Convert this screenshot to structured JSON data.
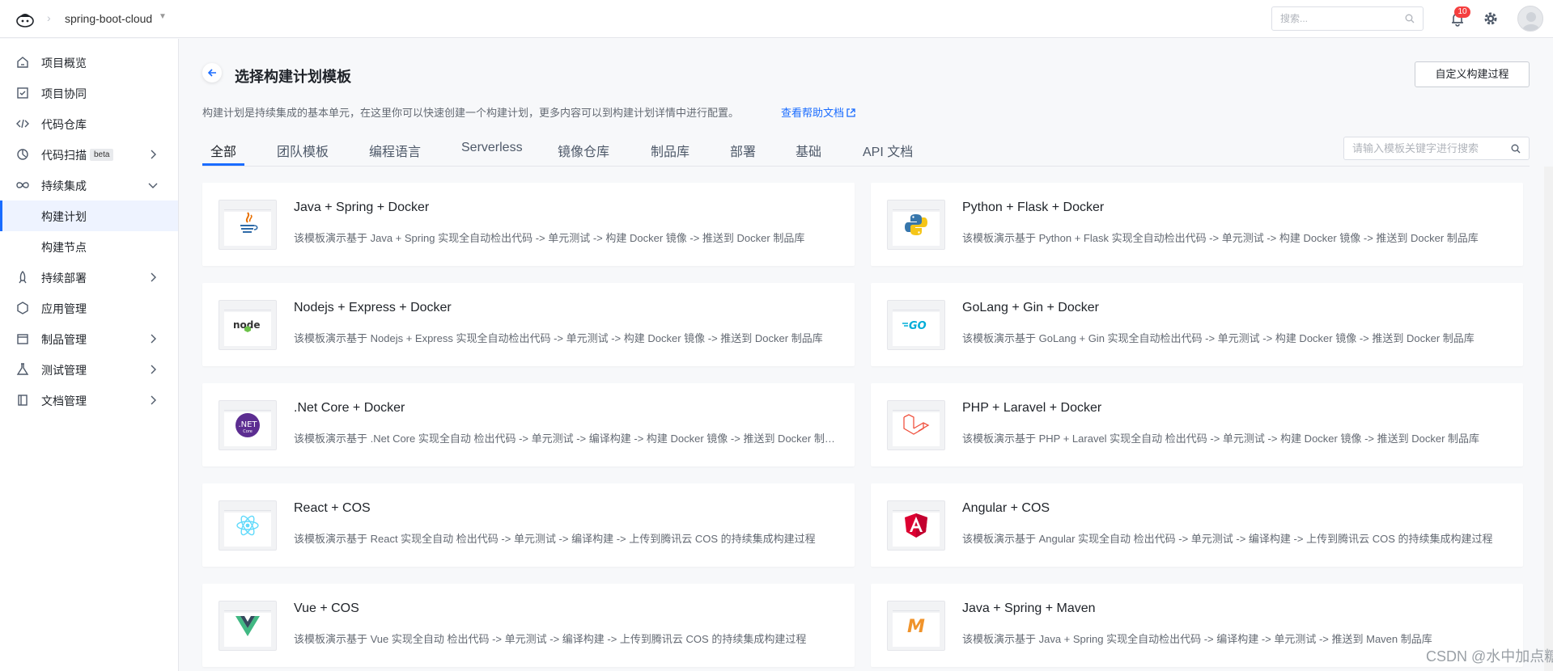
{
  "topbar": {
    "project_name": "spring-boot-cloud",
    "search_placeholder": "搜索...",
    "notification_count": "10"
  },
  "sidebar": {
    "items": [
      {
        "label": "项目概览",
        "icon": "home-icon"
      },
      {
        "label": "项目协同",
        "icon": "checkbox-icon"
      },
      {
        "label": "代码仓库",
        "icon": "code-icon"
      },
      {
        "label": "代码扫描",
        "icon": "scan-icon",
        "badge": "beta"
      },
      {
        "label": "持续集成",
        "icon": "infinity-icon"
      },
      {
        "label": "构建计划"
      },
      {
        "label": "构建节点"
      },
      {
        "label": "持续部署",
        "icon": "rocket-icon"
      },
      {
        "label": "应用管理",
        "icon": "hexagon-icon"
      },
      {
        "label": "制品管理",
        "icon": "box-icon"
      },
      {
        "label": "测试管理",
        "icon": "flask-icon"
      },
      {
        "label": "文档管理",
        "icon": "book-icon"
      }
    ]
  },
  "page": {
    "title": "选择构建计划模板",
    "custom_button": "自定义构建过程",
    "description": "构建计划是持续集成的基本单元，在这里你可以快速创建一个构建计划，更多内容可以到构建计划详情中进行配置。",
    "help_link": "查看帮助文档",
    "tabs": [
      "全部",
      "团队模板",
      "编程语言",
      "Serverless",
      "镜像仓库",
      "制品库",
      "部署",
      "基础",
      "API 文档"
    ],
    "active_tab": "全部",
    "template_search_placeholder": "请输入模板关键字进行搜索"
  },
  "templates": [
    {
      "title": "Java + Spring + Docker",
      "desc": "该模板演示基于 Java + Spring 实现全自动检出代码 -> 单元测试 -> 构建 Docker 镜像 -> 推送到 Docker 制品库",
      "icon": "java-icon"
    },
    {
      "title": "Python + Flask + Docker",
      "desc": "该模板演示基于 Python + Flask 实现全自动检出代码 -> 单元测试 -> 构建 Docker 镜像 -> 推送到 Docker 制品库",
      "icon": "python-icon"
    },
    {
      "title": "Nodejs + Express + Docker",
      "desc": "该模板演示基于 Nodejs + Express 实现全自动检出代码 -> 单元测试 -> 构建 Docker 镜像 -> 推送到 Docker 制品库",
      "icon": "nodejs-icon"
    },
    {
      "title": "GoLang + Gin + Docker",
      "desc": "该模板演示基于 GoLang + Gin 实现全自动检出代码 -> 单元测试 -> 构建 Docker 镜像 -> 推送到 Docker 制品库",
      "icon": "golang-icon"
    },
    {
      "title": ".Net Core + Docker",
      "desc": "该模板演示基于 .Net Core 实现全自动 检出代码 -> 单元测试 -> 编译构建 -> 构建 Docker 镜像 -> 推送到 Docker 制品库",
      "icon": "dotnet-icon"
    },
    {
      "title": "PHP + Laravel + Docker",
      "desc": "该模板演示基于 PHP + Laravel 实现全自动 检出代码 -> 单元测试 -> 构建 Docker 镜像 -> 推送到 Docker 制品库",
      "icon": "laravel-icon"
    },
    {
      "title": "React + COS",
      "desc": "该模板演示基于 React 实现全自动 检出代码 -> 单元测试 -> 编译构建 -> 上传到腾讯云 COS 的持续集成构建过程",
      "icon": "react-icon"
    },
    {
      "title": "Angular + COS",
      "desc": "该模板演示基于 Angular 实现全自动 检出代码 -> 单元测试 -> 编译构建 -> 上传到腾讯云 COS 的持续集成构建过程",
      "icon": "angular-icon"
    },
    {
      "title": "Vue + COS",
      "desc": "该模板演示基于 Vue 实现全自动 检出代码 -> 单元测试 -> 编译构建 -> 上传到腾讯云 COS 的持续集成构建过程",
      "icon": "vue-icon"
    },
    {
      "title": "Java + Spring + Maven",
      "desc": "该模板演示基于 Java + Spring 实现全自动检出代码 -> 编译构建 -> 单元测试 -> 推送到 Maven 制品库",
      "icon": "maven-icon"
    }
  ],
  "watermark": "CSDN @水中加点糖",
  "colors": {
    "accent": "#1a6cff",
    "badge": "#f53f3f"
  }
}
